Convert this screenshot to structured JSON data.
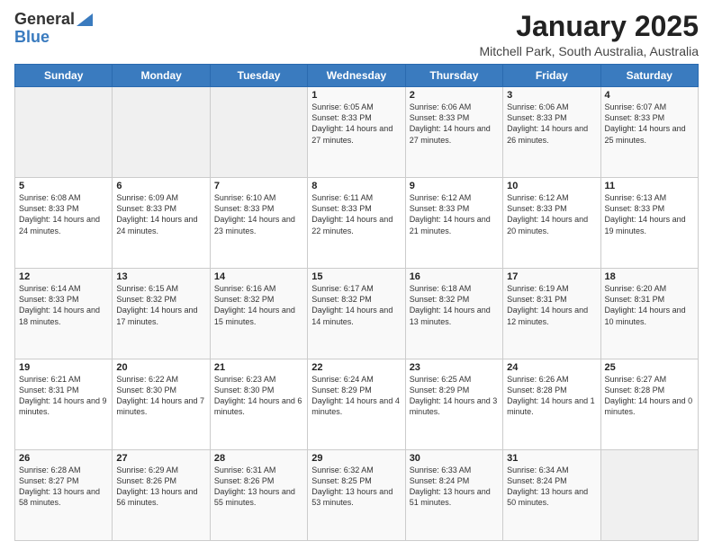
{
  "logo": {
    "general": "General",
    "blue": "Blue"
  },
  "title": {
    "month": "January 2025",
    "location": "Mitchell Park, South Australia, Australia"
  },
  "weekdays": [
    "Sunday",
    "Monday",
    "Tuesday",
    "Wednesday",
    "Thursday",
    "Friday",
    "Saturday"
  ],
  "weeks": [
    [
      {
        "day": "",
        "info": ""
      },
      {
        "day": "",
        "info": ""
      },
      {
        "day": "",
        "info": ""
      },
      {
        "day": "1",
        "info": "Sunrise: 6:05 AM\nSunset: 8:33 PM\nDaylight: 14 hours and 27 minutes."
      },
      {
        "day": "2",
        "info": "Sunrise: 6:06 AM\nSunset: 8:33 PM\nDaylight: 14 hours and 27 minutes."
      },
      {
        "day": "3",
        "info": "Sunrise: 6:06 AM\nSunset: 8:33 PM\nDaylight: 14 hours and 26 minutes."
      },
      {
        "day": "4",
        "info": "Sunrise: 6:07 AM\nSunset: 8:33 PM\nDaylight: 14 hours and 25 minutes."
      }
    ],
    [
      {
        "day": "5",
        "info": "Sunrise: 6:08 AM\nSunset: 8:33 PM\nDaylight: 14 hours and 24 minutes."
      },
      {
        "day": "6",
        "info": "Sunrise: 6:09 AM\nSunset: 8:33 PM\nDaylight: 14 hours and 24 minutes."
      },
      {
        "day": "7",
        "info": "Sunrise: 6:10 AM\nSunset: 8:33 PM\nDaylight: 14 hours and 23 minutes."
      },
      {
        "day": "8",
        "info": "Sunrise: 6:11 AM\nSunset: 8:33 PM\nDaylight: 14 hours and 22 minutes."
      },
      {
        "day": "9",
        "info": "Sunrise: 6:12 AM\nSunset: 8:33 PM\nDaylight: 14 hours and 21 minutes."
      },
      {
        "day": "10",
        "info": "Sunrise: 6:12 AM\nSunset: 8:33 PM\nDaylight: 14 hours and 20 minutes."
      },
      {
        "day": "11",
        "info": "Sunrise: 6:13 AM\nSunset: 8:33 PM\nDaylight: 14 hours and 19 minutes."
      }
    ],
    [
      {
        "day": "12",
        "info": "Sunrise: 6:14 AM\nSunset: 8:33 PM\nDaylight: 14 hours and 18 minutes."
      },
      {
        "day": "13",
        "info": "Sunrise: 6:15 AM\nSunset: 8:32 PM\nDaylight: 14 hours and 17 minutes."
      },
      {
        "day": "14",
        "info": "Sunrise: 6:16 AM\nSunset: 8:32 PM\nDaylight: 14 hours and 15 minutes."
      },
      {
        "day": "15",
        "info": "Sunrise: 6:17 AM\nSunset: 8:32 PM\nDaylight: 14 hours and 14 minutes."
      },
      {
        "day": "16",
        "info": "Sunrise: 6:18 AM\nSunset: 8:32 PM\nDaylight: 14 hours and 13 minutes."
      },
      {
        "day": "17",
        "info": "Sunrise: 6:19 AM\nSunset: 8:31 PM\nDaylight: 14 hours and 12 minutes."
      },
      {
        "day": "18",
        "info": "Sunrise: 6:20 AM\nSunset: 8:31 PM\nDaylight: 14 hours and 10 minutes."
      }
    ],
    [
      {
        "day": "19",
        "info": "Sunrise: 6:21 AM\nSunset: 8:31 PM\nDaylight: 14 hours and 9 minutes."
      },
      {
        "day": "20",
        "info": "Sunrise: 6:22 AM\nSunset: 8:30 PM\nDaylight: 14 hours and 7 minutes."
      },
      {
        "day": "21",
        "info": "Sunrise: 6:23 AM\nSunset: 8:30 PM\nDaylight: 14 hours and 6 minutes."
      },
      {
        "day": "22",
        "info": "Sunrise: 6:24 AM\nSunset: 8:29 PM\nDaylight: 14 hours and 4 minutes."
      },
      {
        "day": "23",
        "info": "Sunrise: 6:25 AM\nSunset: 8:29 PM\nDaylight: 14 hours and 3 minutes."
      },
      {
        "day": "24",
        "info": "Sunrise: 6:26 AM\nSunset: 8:28 PM\nDaylight: 14 hours and 1 minute."
      },
      {
        "day": "25",
        "info": "Sunrise: 6:27 AM\nSunset: 8:28 PM\nDaylight: 14 hours and 0 minutes."
      }
    ],
    [
      {
        "day": "26",
        "info": "Sunrise: 6:28 AM\nSunset: 8:27 PM\nDaylight: 13 hours and 58 minutes."
      },
      {
        "day": "27",
        "info": "Sunrise: 6:29 AM\nSunset: 8:26 PM\nDaylight: 13 hours and 56 minutes."
      },
      {
        "day": "28",
        "info": "Sunrise: 6:31 AM\nSunset: 8:26 PM\nDaylight: 13 hours and 55 minutes."
      },
      {
        "day": "29",
        "info": "Sunrise: 6:32 AM\nSunset: 8:25 PM\nDaylight: 13 hours and 53 minutes."
      },
      {
        "day": "30",
        "info": "Sunrise: 6:33 AM\nSunset: 8:24 PM\nDaylight: 13 hours and 51 minutes."
      },
      {
        "day": "31",
        "info": "Sunrise: 6:34 AM\nSunset: 8:24 PM\nDaylight: 13 hours and 50 minutes."
      },
      {
        "day": "",
        "info": ""
      }
    ]
  ]
}
